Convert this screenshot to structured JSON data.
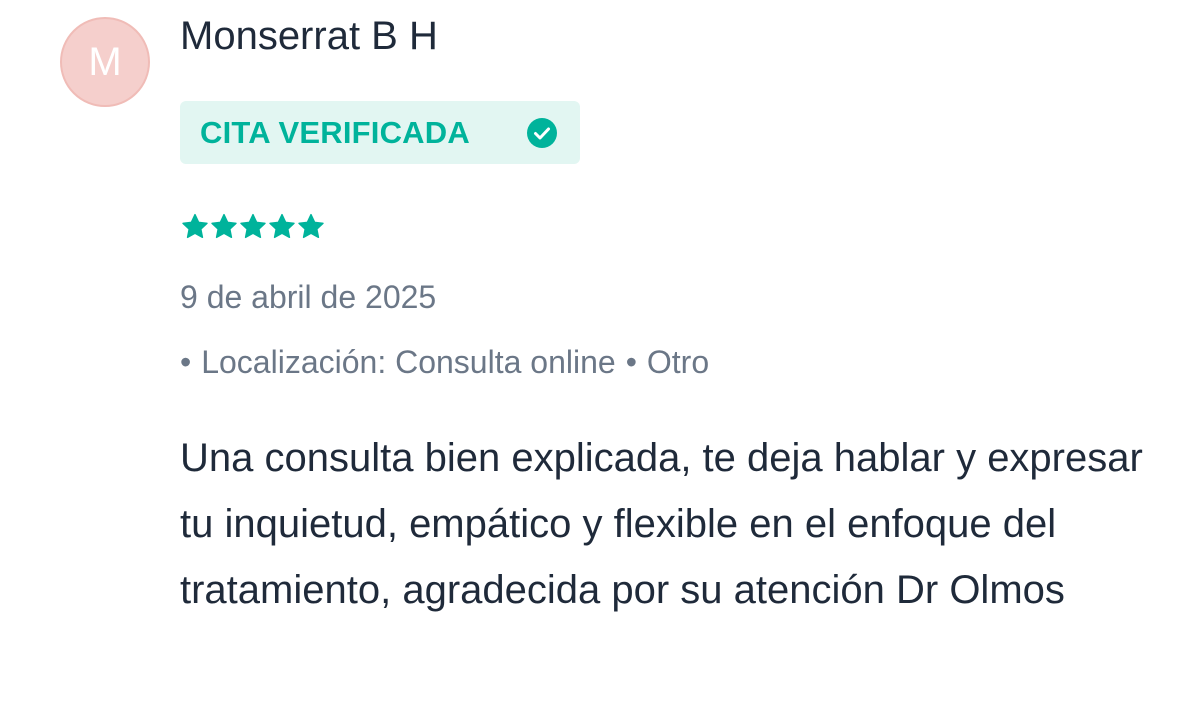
{
  "review": {
    "avatar_initial": "M",
    "reviewer_name": "Monserrat B H",
    "badge_label": "CITA VERIFICADA",
    "rating": 5,
    "rating_max": 5,
    "date": "9 de abril de 2025",
    "meta_bullet": "•",
    "location_text": "Localización: Consulta online",
    "service_text": "Otro",
    "text": "Una consulta bien explicada, te deja hablar y expresar tu inquietud, empático y flexible en el enfoque del tratamiento, agradecida por su atención Dr Olmos"
  },
  "icons": {
    "badge_icon": "check-circle-icon",
    "star_icon": "star-icon"
  },
  "colors": {
    "accent": "#00b39b",
    "badge_bg": "#e2f6f2",
    "avatar_bg": "#f5cfcc",
    "text_primary": "#1f2a3a",
    "text_secondary": "#6b7787"
  }
}
